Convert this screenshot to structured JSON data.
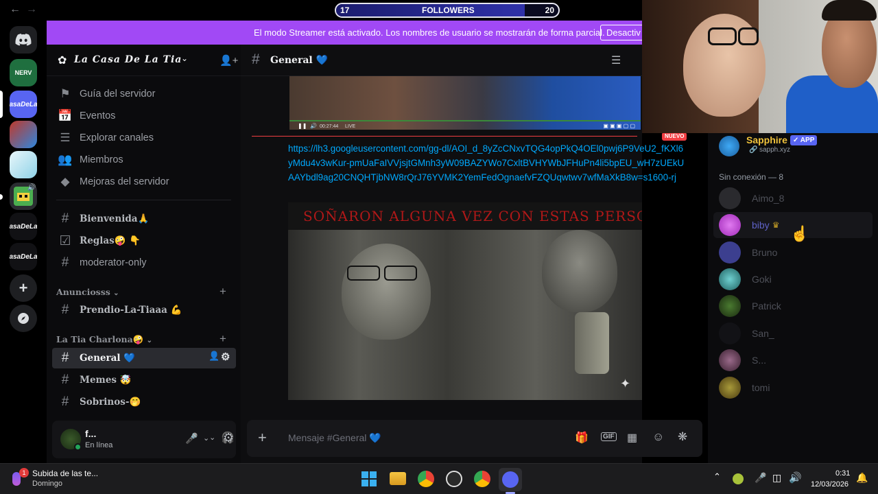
{
  "stream_overlay": {
    "followers_label": "FOLLOWERS",
    "current": "17",
    "goal": "20",
    "progress_fraction": 0.85
  },
  "banner": {
    "text": "El modo Streamer está activado. Los nombres de usuario se mostrarán de forma parcial.",
    "button": "Desactiv"
  },
  "guilds": [
    {
      "label": "NERV",
      "color": "#1f6f3f"
    },
    {
      "label": "asaDeLa",
      "color": "#5865f2"
    },
    {
      "label": "",
      "color": "#c0392b"
    },
    {
      "label": "",
      "color": "#8fd3e8"
    },
    {
      "label": "",
      "color": "#4caf50"
    },
    {
      "label": "asaDeLa",
      "color": "#111114"
    },
    {
      "label": "asaDeLa",
      "color": "#111114"
    }
  ],
  "server": {
    "name": "La Casa De La Tia",
    "menu": [
      {
        "icon": "signpost-icon",
        "label": "Guía del servidor"
      },
      {
        "icon": "calendar-icon",
        "label": "Eventos"
      },
      {
        "icon": "browse-channels-icon",
        "label": "Explorar canales"
      },
      {
        "icon": "members-icon",
        "label": "Miembros"
      },
      {
        "icon": "boost-icon",
        "label": "Mejoras del servidor"
      }
    ],
    "channels_top": [
      {
        "icon": "hash-icon",
        "label": "Bienvenida🙏"
      },
      {
        "icon": "rules-icon",
        "label": "Reglas🤪 👇"
      },
      {
        "icon": "hash-icon",
        "label": "moderator-only"
      }
    ],
    "category1": {
      "name": "Anunciosss",
      "channels": [
        "Prendio-La-Tiaaa 💪"
      ]
    },
    "category2": {
      "name": "La Tia Charlona🤪",
      "channels": [
        "General 💙",
        "Memes 🤯",
        "Sobrinos-🤭"
      ]
    }
  },
  "user_panel": {
    "name": "f...",
    "status": "En línea"
  },
  "chat": {
    "channel_name": "General 💙",
    "new_badge": "NUEVO",
    "video_time": "00:27:44",
    "video_live": "LIVE",
    "link": "https://lh3.googleusercontent.com/gg-dl/AOI_d_8yZcCNxvTQG4opPkQ4OEl0pwj6P9VeU2_fKXl6yMdu4v3wKur-pmUaFaIVVjsjtGMnh3yW09BAZYWo7CxltBVHYWbJFHuPn4li5bpEU_wH7zUEkUAAYbdl9ag20CNQHTjbNW8rQrJ76YVMK2YemFedOgnaefvFZQUqwtwv7wfMaXkB8w=s1600-rj",
    "image_caption": "SOÑARON ALGUNA VEZ CON ESTAS PERSONAS?",
    "composer_placeholder": "Mensaje #General 💙"
  },
  "member_list": {
    "app_member": {
      "name": "Sapphire",
      "tag": "APP",
      "sub": "sapph.xyz"
    },
    "offline_header": "Sin conexión — 8",
    "offline": [
      {
        "name": "Aimo_8",
        "color": "#2a2a2e"
      },
      {
        "name": "biby",
        "color": "#c03ad6"
      },
      {
        "name": "Bruno",
        "color": "#5865f2"
      },
      {
        "name": "Goki",
        "color": "#2fa3a3"
      },
      {
        "name": "Patrick",
        "color": "#3c6e2c"
      },
      {
        "name": "San_",
        "color": "#0d0d10"
      },
      {
        "name": "S...",
        "color": "#6a3a5a"
      },
      {
        "name": "tomi",
        "color": "#8a7a2a"
      }
    ]
  },
  "taskbar": {
    "notification_title": "Subida de las te...",
    "notification_sub": "Domingo",
    "notification_badge": "1",
    "time": "0:31",
    "date": "12/03/2026"
  }
}
